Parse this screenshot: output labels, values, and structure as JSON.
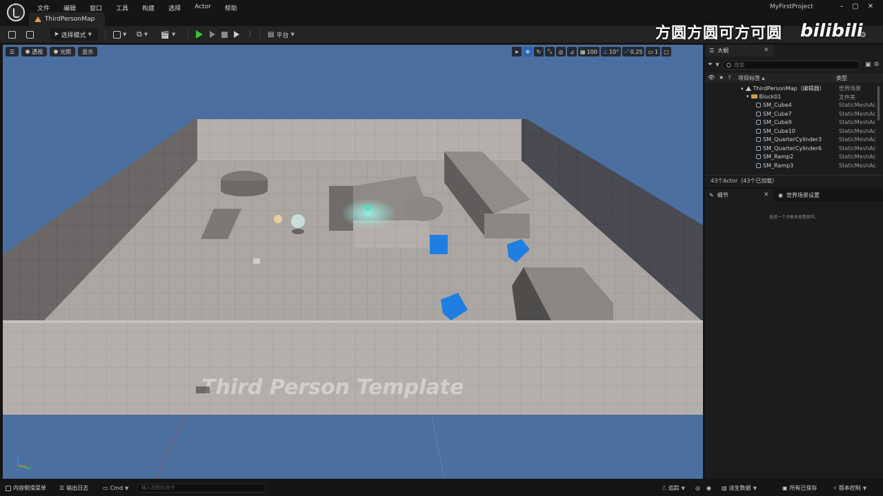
{
  "menu": [
    "文件",
    "编辑",
    "窗口",
    "工具",
    "构建",
    "选择",
    "Actor",
    "帮助"
  ],
  "map_tab": "ThirdPersonMap",
  "project_name": "MyFirstProject",
  "toolbar": {
    "mode_label": "选择模式",
    "platform_label": "平台"
  },
  "watermark": "方圆方圆可方可圆",
  "bili_logo": "bilibili",
  "viewport": {
    "perspective": "透视",
    "lighting": "光照",
    "show": "显示",
    "grid_snap": "100",
    "rotation_snap": "10°",
    "scale_snap": "0.25",
    "camera_speed": "1",
    "scene_text": "Third Person Template",
    "colors": {
      "sky": "#4b6f9f",
      "floor": "#a7a29e",
      "wall": "#b3aeaa",
      "cube": "#1f7fe0"
    }
  },
  "outliner": {
    "tab": "大纲",
    "search_placeholder": "搜索",
    "col_label": "项目标签 ▴",
    "col_type": "类型",
    "rows": [
      {
        "label": "ThirdPersonMap（编辑器）",
        "type": "世界场景",
        "icon": "map-icon"
      },
      {
        "label": "Block01",
        "type": "文件夹",
        "icon": "folder-icon"
      },
      {
        "label": "SM_Cube4",
        "type": "StaticMeshAc",
        "icon": "mesh-icon"
      },
      {
        "label": "SM_Cube7",
        "type": "StaticMeshAc",
        "icon": "mesh-icon"
      },
      {
        "label": "SM_Cube9",
        "type": "StaticMeshAc",
        "icon": "mesh-icon"
      },
      {
        "label": "SM_Cube10",
        "type": "StaticMeshAc",
        "icon": "mesh-icon"
      },
      {
        "label": "SM_QuarterCylinder3",
        "type": "StaticMeshAc",
        "icon": "mesh-icon"
      },
      {
        "label": "SM_QuarterCylinder6",
        "type": "StaticMeshAc",
        "icon": "mesh-icon"
      },
      {
        "label": "SM_Ramp2",
        "type": "StaticMeshAc",
        "icon": "mesh-icon"
      },
      {
        "label": "SM_Ramp3",
        "type": "StaticMeshAc",
        "icon": "mesh-icon"
      }
    ],
    "status": "43个Actor（43个已加载）"
  },
  "details": {
    "tab_details": "细节",
    "tab_world": "世界场景设置",
    "empty_hint": "选择一个对象来查看细节。"
  },
  "statusbar": {
    "content_drawer": "内容侧滑菜单",
    "output_log": "输出日志",
    "cmd": "Cmd",
    "console_placeholder": "输入控制台命令",
    "trace": "追踪",
    "derived_data": "派生数据",
    "all_saved": "所有已保存",
    "source_control": "版本控制"
  }
}
